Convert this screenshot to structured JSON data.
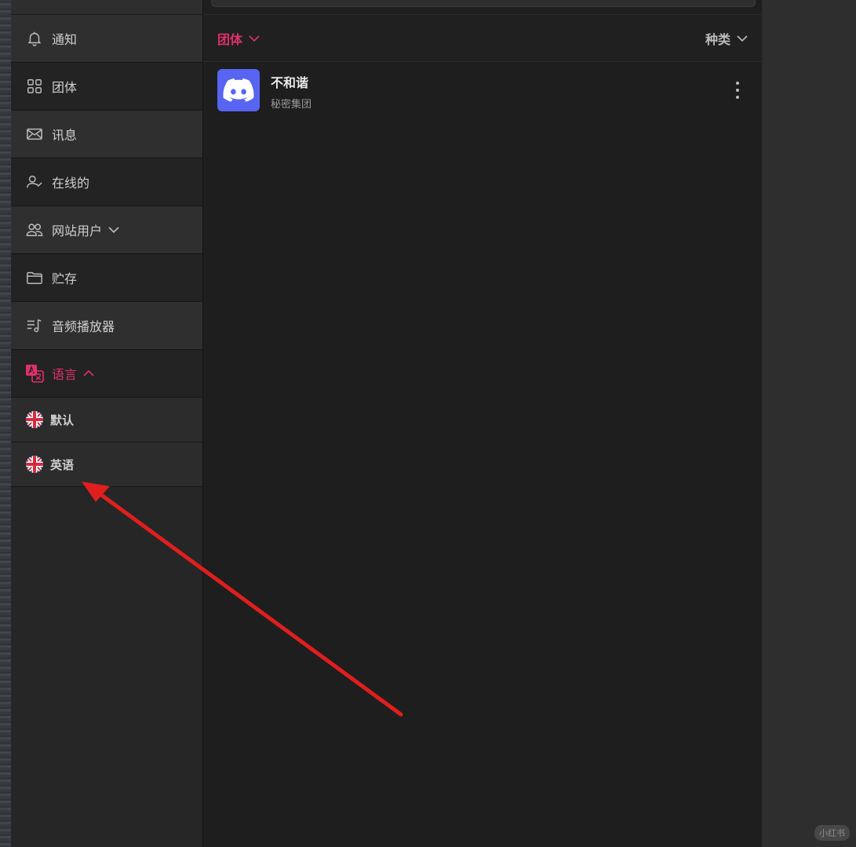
{
  "sidebar": {
    "items": [
      {
        "label": "通知",
        "icon": "bell-icon"
      },
      {
        "label": "团体",
        "icon": "grid-icon"
      },
      {
        "label": "讯息",
        "icon": "envelope-icon"
      },
      {
        "label": "在线的",
        "icon": "user-check-icon"
      },
      {
        "label": "网站用户",
        "icon": "users-icon"
      },
      {
        "label": "贮存",
        "icon": "folder-icon"
      },
      {
        "label": "音频播放器",
        "icon": "music-list-icon"
      },
      {
        "label": "语言",
        "icon": "translate-icon"
      }
    ],
    "language_options": [
      {
        "label": "默认",
        "icon": "uk-flag-icon"
      },
      {
        "label": "英语",
        "icon": "uk-flag-icon"
      }
    ]
  },
  "main": {
    "group_filter_label": "团体",
    "category_filter_label": "种类",
    "groups": [
      {
        "name": "不和谐",
        "description": "秘密集团",
        "icon": "discord-icon"
      }
    ]
  },
  "watermark": "小红书",
  "colors": {
    "accent": "#e0306b",
    "discord": "#5865f2",
    "annotation_arrow": "#e01e1e"
  }
}
